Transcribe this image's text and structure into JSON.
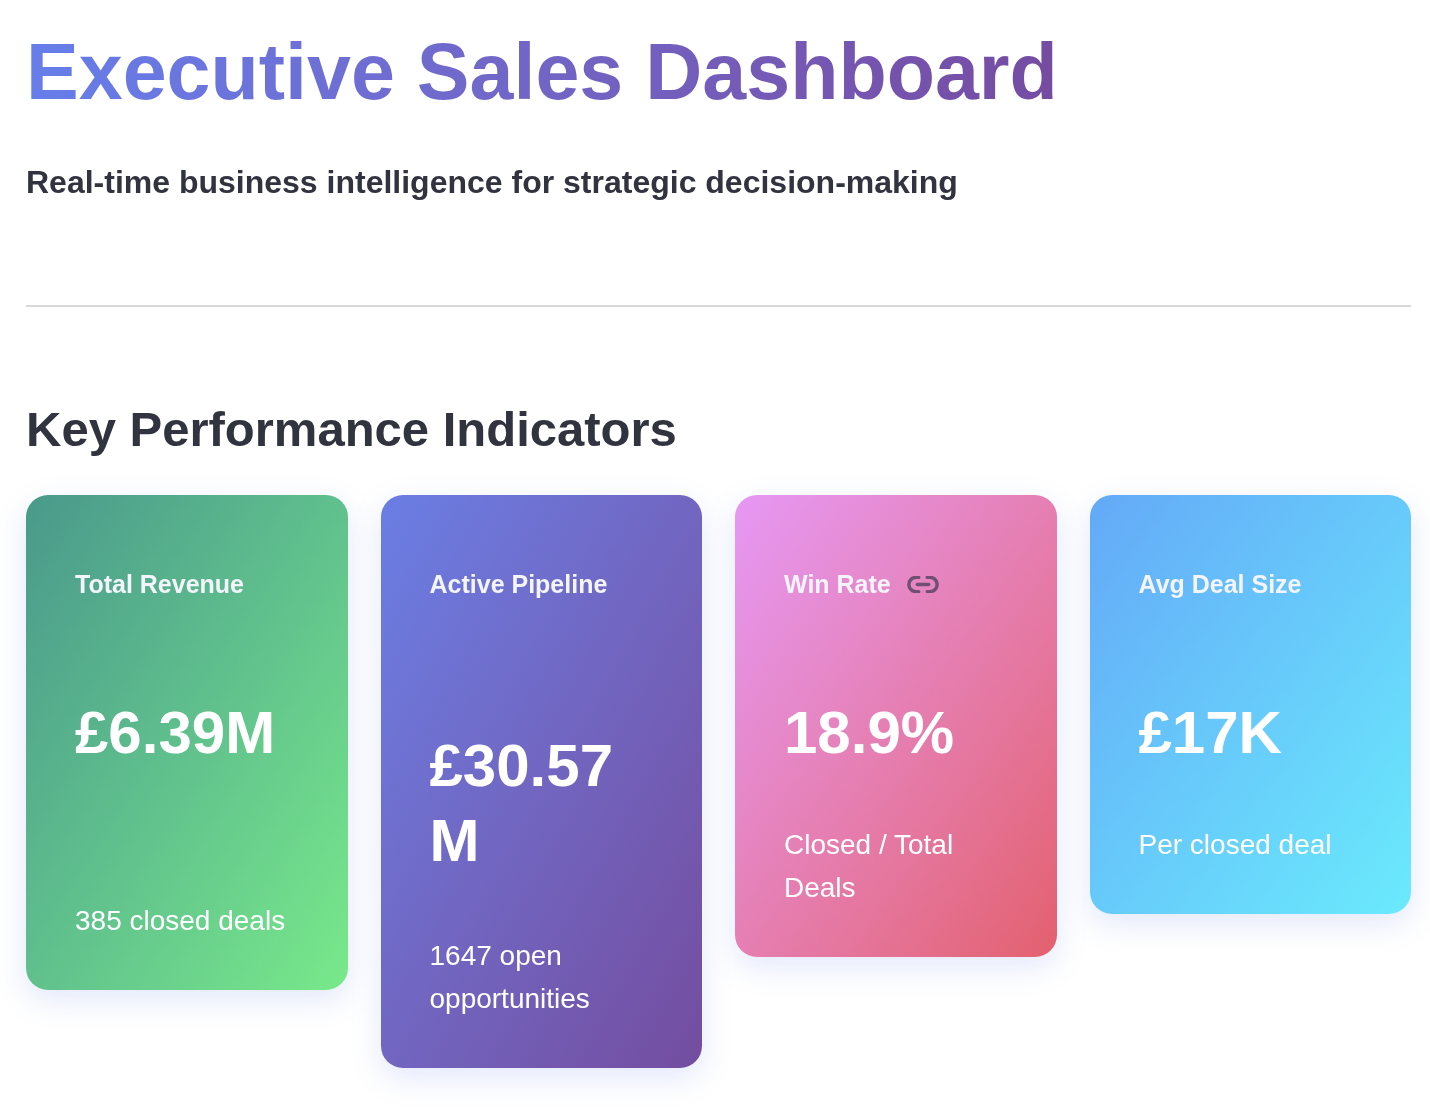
{
  "header": {
    "title": "Executive Sales Dashboard",
    "subtitle": "Real-time business intelligence for strategic decision-making"
  },
  "kpi_section": {
    "heading": "Key Performance Indicators",
    "cards": [
      {
        "label": "Total Revenue",
        "value": "£6.39M",
        "caption": "385 closed deals",
        "link_icon": false
      },
      {
        "label": "Active Pipeline",
        "value": "£30.57M",
        "caption": "1647 open opportunities",
        "link_icon": false
      },
      {
        "label": "Win Rate",
        "value": "18.9%",
        "caption": "Closed / Total Deals",
        "link_icon": true
      },
      {
        "label": "Avg Deal Size",
        "value": "£17K",
        "caption": "Per closed deal",
        "link_icon": false
      }
    ]
  }
}
